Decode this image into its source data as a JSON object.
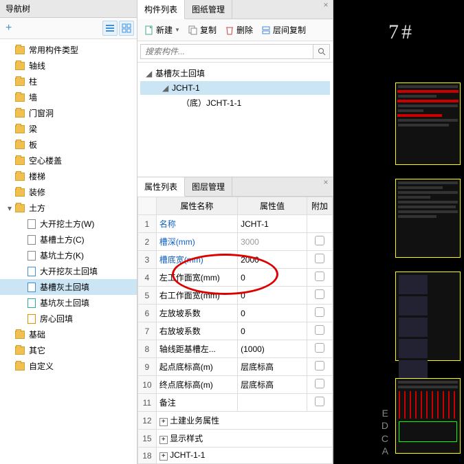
{
  "nav": {
    "title": "导航树",
    "items": [
      {
        "label": "常用构件类型",
        "lvl": 1,
        "icon": "folder"
      },
      {
        "label": "轴线",
        "lvl": 1,
        "icon": "folder"
      },
      {
        "label": "柱",
        "lvl": 1,
        "icon": "folder"
      },
      {
        "label": "墙",
        "lvl": 1,
        "icon": "folder"
      },
      {
        "label": "门窗洞",
        "lvl": 1,
        "icon": "folder"
      },
      {
        "label": "梁",
        "lvl": 1,
        "icon": "folder"
      },
      {
        "label": "板",
        "lvl": 1,
        "icon": "folder"
      },
      {
        "label": "空心楼盖",
        "lvl": 1,
        "icon": "folder"
      },
      {
        "label": "楼梯",
        "lvl": 1,
        "icon": "folder"
      },
      {
        "label": "装修",
        "lvl": 1,
        "icon": "folder"
      },
      {
        "label": "土方",
        "lvl": 1,
        "icon": "folder",
        "expanded": true
      },
      {
        "label": "大开挖土方(W)",
        "lvl": 2,
        "icon": "doc"
      },
      {
        "label": "基槽土方(C)",
        "lvl": 2,
        "icon": "doc"
      },
      {
        "label": "基坑土方(K)",
        "lvl": 2,
        "icon": "doc"
      },
      {
        "label": "大开挖灰土回填",
        "lvl": 2,
        "icon": "doc-blue"
      },
      {
        "label": "基槽灰土回填",
        "lvl": 2,
        "icon": "doc-blue",
        "selected": true
      },
      {
        "label": "基坑灰土回填",
        "lvl": 2,
        "icon": "doc-green"
      },
      {
        "label": "房心回填",
        "lvl": 2,
        "icon": "doc-orange"
      },
      {
        "label": "基础",
        "lvl": 1,
        "icon": "folder"
      },
      {
        "label": "其它",
        "lvl": 1,
        "icon": "folder"
      },
      {
        "label": "自定义",
        "lvl": 1,
        "icon": "folder"
      }
    ]
  },
  "componentPanel": {
    "tabs": [
      {
        "label": "构件列表",
        "active": true
      },
      {
        "label": "图纸管理"
      }
    ],
    "toolbar": {
      "new": "新建",
      "copy": "复制",
      "delete": "删除",
      "floorcopy": "层间复制"
    },
    "search_placeholder": "搜索构件...",
    "tree": [
      {
        "label": "基槽灰土回填",
        "lvl": 0
      },
      {
        "label": "JCHT-1",
        "lvl": 1,
        "selected": true
      },
      {
        "label": "（底）JCHT-1-1",
        "lvl": 2
      }
    ]
  },
  "propPanel": {
    "tabs": [
      {
        "label": "属性列表",
        "active": true
      },
      {
        "label": "图层管理"
      }
    ],
    "headers": {
      "name": "属性名称",
      "value": "属性值",
      "extra": "附加"
    },
    "rows": [
      {
        "n": "1",
        "name": "名称",
        "val": "JCHT-1",
        "link": true
      },
      {
        "n": "2",
        "name": "槽深(mm)",
        "val": "3000",
        "link": true,
        "gray": true,
        "chk": true
      },
      {
        "n": "3",
        "name": "槽底宽(mm)",
        "val": "2000",
        "link": true,
        "chk": true
      },
      {
        "n": "4",
        "name": "左工作面宽(mm)",
        "val": "0",
        "chk": true
      },
      {
        "n": "5",
        "name": "右工作面宽(mm)",
        "val": "0",
        "chk": true
      },
      {
        "n": "6",
        "name": "左放坡系数",
        "val": "0",
        "chk": true
      },
      {
        "n": "7",
        "name": "右放坡系数",
        "val": "0",
        "chk": true
      },
      {
        "n": "8",
        "name": "轴线距基槽左...",
        "val": "(1000)",
        "chk": true
      },
      {
        "n": "9",
        "name": "起点底标高(m)",
        "val": "层底标高",
        "chk": true
      },
      {
        "n": "10",
        "name": "终点底标高(m)",
        "val": "层底标高",
        "chk": true
      },
      {
        "n": "11",
        "name": "备注",
        "val": "",
        "chk": true
      },
      {
        "n": "12",
        "name": "土建业务属性",
        "val": "",
        "exp": true
      },
      {
        "n": "15",
        "name": "显示样式",
        "val": "",
        "exp": true
      },
      {
        "n": "18",
        "name": "JCHT-1-1",
        "val": "",
        "exp": true
      }
    ]
  },
  "viewport": {
    "label": "7#"
  }
}
